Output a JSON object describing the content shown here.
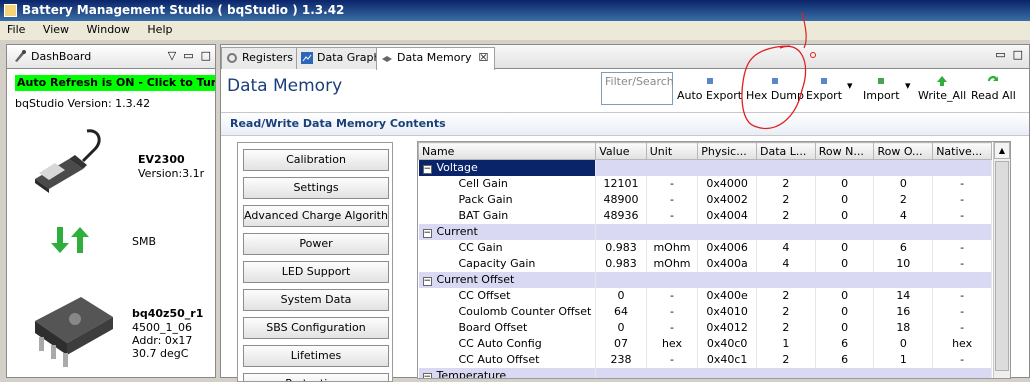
{
  "window": {
    "title": "Battery Management Studio ( bqStudio ) 1.3.42"
  },
  "menu": [
    "File",
    "View",
    "Window",
    "Help"
  ],
  "dashboard": {
    "tab_label": "DashBoard",
    "auto_refresh": "Auto Refresh is ON - Click to Turn Off",
    "version": "bqStudio Version:  1.3.42",
    "adapter_name": "EV2300",
    "adapter_version": "Version:3.1r",
    "bus": "SMB",
    "device_name": "bq40z50_r1",
    "device_fw": "4500_1_06",
    "device_addr": "Addr: 0x17",
    "device_temp": "30.7 degC"
  },
  "tabs": [
    {
      "label": "Registers",
      "icon": "gear-icon"
    },
    {
      "label": "Data Graph",
      "icon": "graph-icon"
    },
    {
      "label": "Data Memory",
      "icon": "memory-icon",
      "active": true
    }
  ],
  "data_memory": {
    "title": "Data Memory",
    "filter_placeholder": "Filter/Search",
    "toolbar": {
      "auto_export": "Auto Export",
      "hex_dump": "Hex Dump",
      "export": "Export",
      "import": "Import",
      "write_all": "Write_All",
      "read_all": "Read All"
    },
    "section_title": "Read/Write Data Memory Contents",
    "categories": [
      "Calibration",
      "Settings",
      "Advanced Charge Algorithm",
      "Power",
      "LED Support",
      "System Data",
      "SBS Configuration",
      "Lifetimes",
      "Protections"
    ],
    "columns": [
      "Name",
      "Value",
      "Unit",
      "Physic...",
      "Data L...",
      "Row N...",
      "Row O...",
      "Native..."
    ],
    "groups": [
      {
        "name": "Voltage",
        "rows": [
          [
            "Cell Gain",
            "12101",
            "-",
            "0x4000",
            "2",
            "0",
            "0",
            "-"
          ],
          [
            "Pack Gain",
            "48900",
            "-",
            "0x4002",
            "2",
            "0",
            "2",
            "-"
          ],
          [
            "BAT Gain",
            "48936",
            "-",
            "0x4004",
            "2",
            "0",
            "4",
            "-"
          ]
        ]
      },
      {
        "name": "Current",
        "rows": [
          [
            "CC Gain",
            "0.983",
            "mOhm",
            "0x4006",
            "4",
            "0",
            "6",
            "-"
          ],
          [
            "Capacity Gain",
            "0.983",
            "mOhm",
            "0x400a",
            "4",
            "0",
            "10",
            "-"
          ]
        ]
      },
      {
        "name": "Current Offset",
        "rows": [
          [
            "CC Offset",
            "0",
            "-",
            "0x400e",
            "2",
            "0",
            "14",
            "-"
          ],
          [
            "Coulomb Counter Offset Samples",
            "64",
            "-",
            "0x4010",
            "2",
            "0",
            "16",
            "-"
          ],
          [
            "Board Offset",
            "0",
            "-",
            "0x4012",
            "2",
            "0",
            "18",
            "-"
          ],
          [
            "CC Auto Config",
            "07",
            "hex",
            "0x40c0",
            "1",
            "6",
            "0",
            "hex"
          ],
          [
            "CC Auto Offset",
            "238",
            "-",
            "0x40c1",
            "2",
            "6",
            "1",
            "-"
          ]
        ]
      },
      {
        "name": "Temperature",
        "rows": []
      }
    ]
  }
}
